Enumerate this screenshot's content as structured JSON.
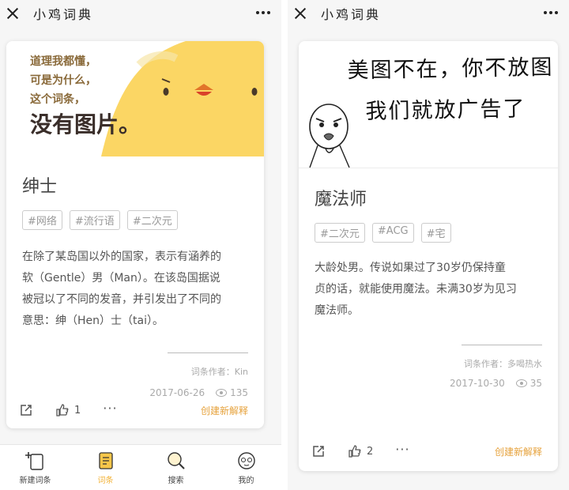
{
  "screens": [
    {
      "app_title": "小鸡词典",
      "banner_text": [
        "道理我都懂，",
        "可是为什么，",
        "这个词条，",
        "没有图片。"
      ],
      "word": "绅士",
      "tags": [
        "#网络",
        "#流行语",
        "#二次元"
      ],
      "description": [
        "在除了某岛国以外的国家，表示有涵养的",
        "软（Gentle）男（Man）。在该岛国据说",
        "被冠以了不同的发音，并引发出了不同的",
        "意思：绅（Hen）士（tai）。"
      ],
      "author": "词条作者：Kin",
      "date": "2017-06-26",
      "views": "135",
      "likes": "1",
      "more_label": "···",
      "create_label": "创建新解释"
    },
    {
      "app_title": "小鸡词典",
      "banner_text": [
        "美图不在，你不放图",
        "我们就放广告了"
      ],
      "word": "魔法师",
      "tags": [
        "#二次元",
        "#ACG",
        "#宅"
      ],
      "description": [
        "大龄处男。传说如果过了30岁仍保持童",
        "贞的话，就能使用魔法。未满30岁为见习",
        "魔法师。"
      ],
      "author": "词条作者：多喝热水",
      "date": "2017-10-30",
      "views": "35",
      "likes": "2",
      "more_label": "···",
      "create_label": "创建新解释"
    }
  ],
  "tabbar": [
    {
      "label": "新建词条",
      "icon": "new-entry-icon",
      "active": false
    },
    {
      "label": "词条",
      "icon": "entries-icon",
      "active": true
    },
    {
      "label": "搜索",
      "icon": "search-icon",
      "active": false
    },
    {
      "label": "我的",
      "icon": "profile-icon",
      "active": false
    }
  ],
  "colors": {
    "accent": "#e6a23c",
    "banner_yellow": "#fbd664",
    "tab_active": "#f2b134"
  }
}
